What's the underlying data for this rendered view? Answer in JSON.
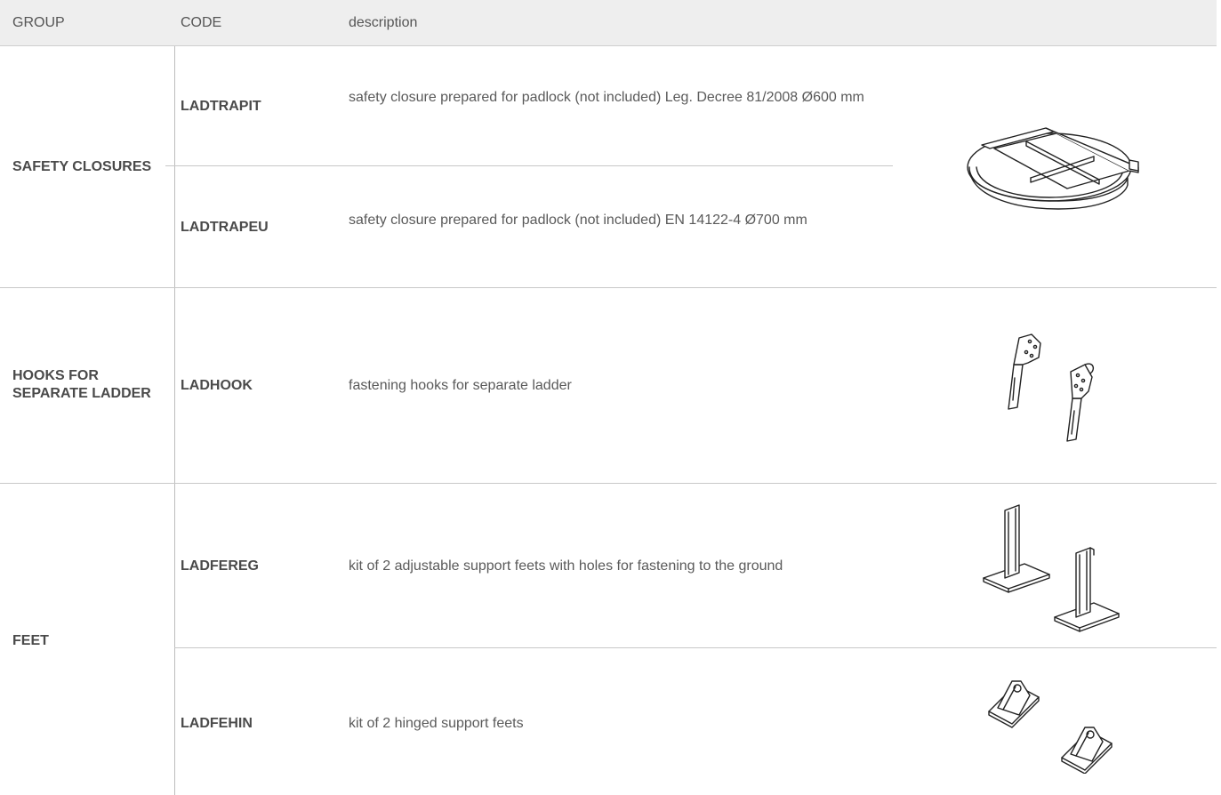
{
  "header": {
    "group": "GROUP",
    "code": "CODE",
    "description": "description"
  },
  "groups": [
    {
      "label": "SAFETY CLOSURES",
      "items": [
        {
          "code": "LADTRAPIT",
          "description": "safety closure prepared for padlock (not included) Leg. Decree 81/2008  Ø600 mm"
        },
        {
          "code": "LADTRAPEU",
          "description": "safety closure prepared for padlock (not included) EN 14122-4 Ø700 mm"
        }
      ],
      "image_icon": "safety-closure-icon"
    },
    {
      "label": "HOOKS FOR SEPARATE LADDER",
      "items": [
        {
          "code": "LADHOOK",
          "description": "fastening hooks for separate ladder"
        }
      ],
      "image_icon": "ladder-hooks-icon"
    },
    {
      "label": "FEET",
      "items": [
        {
          "code": "LADFEREG",
          "description": "kit of 2 adjustable support feets with holes for fastening to the ground",
          "image_icon": "adjustable-feet-icon"
        },
        {
          "code": "LADFEHIN",
          "description": "kit of 2 hinged support feets",
          "image_icon": "hinged-feet-icon"
        }
      ]
    }
  ],
  "colors": {
    "header_bg": "#eeeeee",
    "text": "#4a4a4a",
    "rule": "#c8c8c8"
  }
}
